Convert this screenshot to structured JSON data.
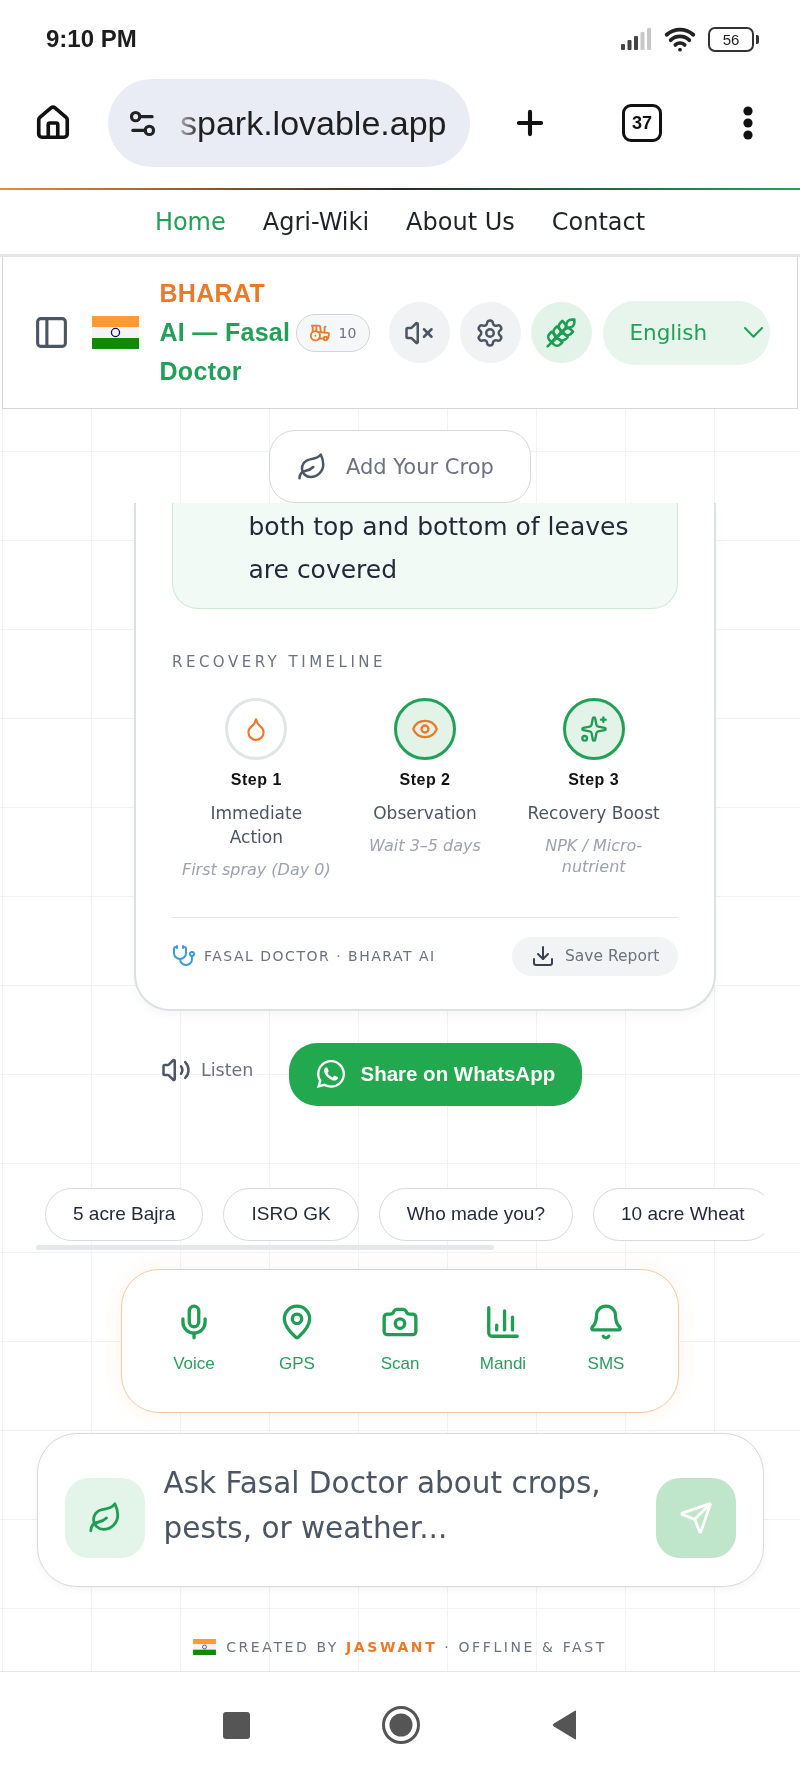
{
  "status_bar": {
    "time": "9:10 PM",
    "battery": "56"
  },
  "browser": {
    "url": "spark.lovable.app",
    "tab_count": "37"
  },
  "nav": [
    {
      "label": "Home",
      "selected": true
    },
    {
      "label": "Agri-Wiki",
      "selected": false
    },
    {
      "label": "About Us",
      "selected": false
    },
    {
      "label": "Contact",
      "selected": false
    }
  ],
  "header": {
    "brand": "BHARAT",
    "title": "AI — Fasal Doctor",
    "badge_count": "10",
    "language": "English"
  },
  "add_crop_button": "Add Your Crop",
  "report": {
    "advice": "both top and bottom of leaves are covered",
    "timeline_title": "RECOVERY TIMELINE",
    "steps": [
      {
        "kind": "drop",
        "label": "Step 1",
        "name": "Immediate Action",
        "note": "First spray (Day 0)",
        "active": false
      },
      {
        "kind": "eye",
        "label": "Step 2",
        "name": "Observation",
        "note": "Wait 3–5 days",
        "active": true
      },
      {
        "kind": "sparkle",
        "label": "Step 3",
        "name": "Recovery Boost",
        "note": "NPK / Micro-nutrient",
        "active": true
      }
    ],
    "source": "FASAL DOCTOR · BHARAT AI",
    "save_button": "Save Report"
  },
  "actions": {
    "listen": "Listen",
    "share": "Share on WhatsApp"
  },
  "suggestions": [
    "5 acre Bajra",
    "ISRO GK",
    "Who made you?",
    "10 acre Wheat"
  ],
  "tools": [
    {
      "kind": "mic",
      "label": "Voice"
    },
    {
      "kind": "pin",
      "label": "GPS"
    },
    {
      "kind": "camera",
      "label": "Scan"
    },
    {
      "kind": "chart",
      "label": "Mandi"
    },
    {
      "kind": "bell",
      "label": "SMS"
    }
  ],
  "composer": {
    "placeholder": "Ask Fasal Doctor about crops, pests, or weather..."
  },
  "credit": "CREATED BY **JASWANT** · OFFLINE & FAST"
}
